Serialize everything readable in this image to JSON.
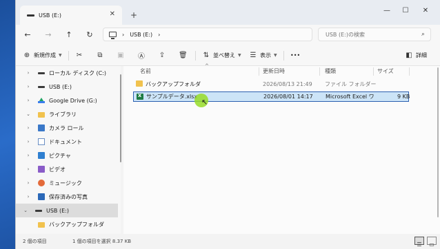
{
  "tab": {
    "title": "USB (E:)",
    "close": "✕",
    "new": "+"
  },
  "window_controls": {
    "minimize": "—",
    "maximize": "☐",
    "close": "✕"
  },
  "nav": {
    "back": "←",
    "forward": "→",
    "up": "↑",
    "refresh": "↻"
  },
  "address": {
    "sep1": "›",
    "location": "USB (E:)",
    "sep2": "›"
  },
  "search": {
    "placeholder": "USB (E:)の検索"
  },
  "toolbar": {
    "new_label": "新規作成",
    "sort_label": "並べ替え",
    "view_label": "表示",
    "more": "•••",
    "details_label": "詳細"
  },
  "sidebar": {
    "items": [
      {
        "label": "ローカル ディスク (C:)",
        "chevron": "›",
        "icon": "drive-icon"
      },
      {
        "label": "USB (E:)",
        "chevron": "›",
        "icon": "usb-drive-icon"
      },
      {
        "label": "Google Drive (G:)",
        "chevron": "›",
        "icon": "google-drive-icon"
      },
      {
        "label": "ライブラリ",
        "chevron": "⌄",
        "icon": "folder-icon"
      },
      {
        "label": "カメラ ロール",
        "chevron": "›",
        "icon": "camera-roll-icon"
      },
      {
        "label": "ドキュメント",
        "chevron": "›",
        "icon": "documents-icon"
      },
      {
        "label": "ピクチャ",
        "chevron": "›",
        "icon": "pictures-icon"
      },
      {
        "label": "ビデオ",
        "chevron": "›",
        "icon": "videos-icon"
      },
      {
        "label": "ミュージック",
        "chevron": "›",
        "icon": "music-icon"
      },
      {
        "label": "保存済みの写真",
        "chevron": "›",
        "icon": "saved-pictures-icon"
      },
      {
        "label": "USB (E:)",
        "chevron": "⌄",
        "icon": "usb-drive-icon"
      },
      {
        "label": "バックアップフォルダ",
        "chevron": "",
        "icon": "folder-icon"
      }
    ]
  },
  "columns": {
    "name": "名前",
    "modified": "更新日時",
    "type": "種類",
    "size": "サイズ"
  },
  "files": [
    {
      "name": "バックアップフォルダ",
      "modified": "2026/08/13 21:49",
      "type": "ファイル フォルダー",
      "size": ""
    },
    {
      "name": "サンプルデータ.xlsx",
      "modified": "2026/08/01 14:17",
      "type": "Microsoft Excel ワ...",
      "size": "9 KB"
    }
  ],
  "status": {
    "count": "2 個の項目",
    "selected": "1 個の項目を選択  8.37 KB"
  }
}
